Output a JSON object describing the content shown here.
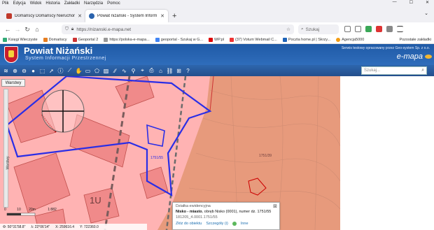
{
  "browser": {
    "menu": [
      "Plik",
      "Edycja",
      "Widok",
      "Historia",
      "Zakładki",
      "Narzędzia",
      "Pomoc"
    ],
    "tabs": [
      {
        "title": "Domańscy Domańscy Nieruchom",
        "active": false
      },
      {
        "title": "Powiat niżański - System Inform",
        "active": true
      }
    ],
    "url": "https://nizanski.e-mapa.net",
    "search_placeholder": "Szukaj",
    "bookmarks": [
      "Księgi Wieczyste",
      "Domańscy",
      "Geoportal 2",
      "https://polska-e-mapa...",
      "geoportal - Szukaj w G...",
      "WP.pl",
      "(37) Votum Webmail C...",
      "Poczta home.pl | Skrzy...",
      "Agencja5000"
    ],
    "bookmarks_other": "Pozostałe zakładki"
  },
  "app": {
    "title": "Powiat Niżański",
    "subtitle": "System Informacji Przestrzennej",
    "service_note": "Serwis testowy opracowany przez Geo-system Sp. z o.o.",
    "brand": "e-mapa",
    "search_placeholder": "Szukaj..."
  },
  "map": {
    "layers_tab": "Warstwy",
    "side_label": "Warstwy",
    "label_1u": "1U",
    "scale_labels": [
      "0",
      "10",
      "20m"
    ],
    "scale_ratio": "1:882",
    "coords": {
      "lat": "Φ: 50°31'58.8\"",
      "lon": "λ: 22°06'14\"",
      "x": "X: 259616.4",
      "y": "Y: 722360.0"
    },
    "plot_label_a": "1751/55",
    "plot_label_b": "1751/39"
  },
  "popup": {
    "title": "Działka ewidencyjna",
    "location": "Nisko - miasto",
    "details": ", obręb Nisko (0001), numer dz. 1751/55",
    "id": "181205_4.0001.1751/55",
    "actions": [
      "Złóż do obiektu",
      "Szczegóły (i)",
      "Inne"
    ]
  },
  "colors": {
    "header_blue": "#2a63ad",
    "parcel_blue": "#2a2ee6",
    "zone_pink": "#ffb3b3",
    "zone_salmon": "#e79a7c"
  }
}
